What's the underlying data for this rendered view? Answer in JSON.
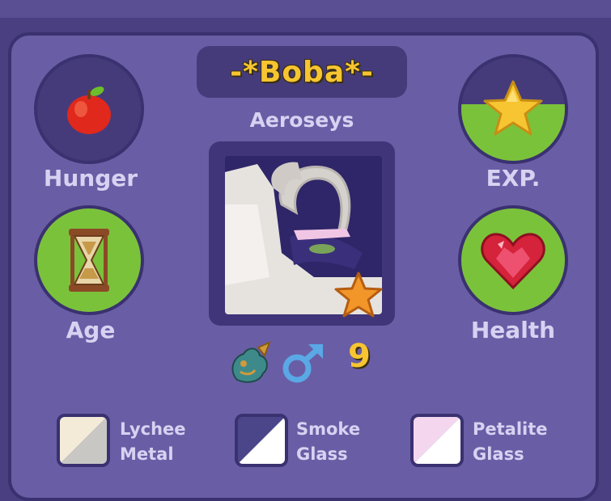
{
  "pet": {
    "name": "-*Boba*-",
    "species": "Aeroseys",
    "level": "9"
  },
  "stats": {
    "hunger_label": "Hunger",
    "age_label": "Age",
    "exp_label": "EXP.",
    "health_label": "Health",
    "hunger_fill": 0.0,
    "age_fill": 1.0,
    "exp_fill": 0.55,
    "health_fill": 1.0
  },
  "icons": {
    "hunger": "apple-icon",
    "age": "hourglass-icon",
    "exp": "star-icon",
    "health": "heart-icon",
    "badge": "star-badge-icon",
    "type": "dragon-icon",
    "gender": "male-icon"
  },
  "colors": {
    "panel": "#695ea5",
    "stat_fill": "#7bc23b",
    "name_gold": "#f7c531"
  },
  "swatches": [
    {
      "line1": "Lychee",
      "line2": "Metal",
      "color_a": "#f3ead8",
      "color_b": "#c9c7c4"
    },
    {
      "line1": "Smoke",
      "line2": "Glass",
      "color_a": "#4b4689",
      "color_b": "#ffffff"
    },
    {
      "line1": "Petalite",
      "line2": "Glass",
      "color_a": "#f4d6ef",
      "color_b": "#ffffff"
    }
  ]
}
